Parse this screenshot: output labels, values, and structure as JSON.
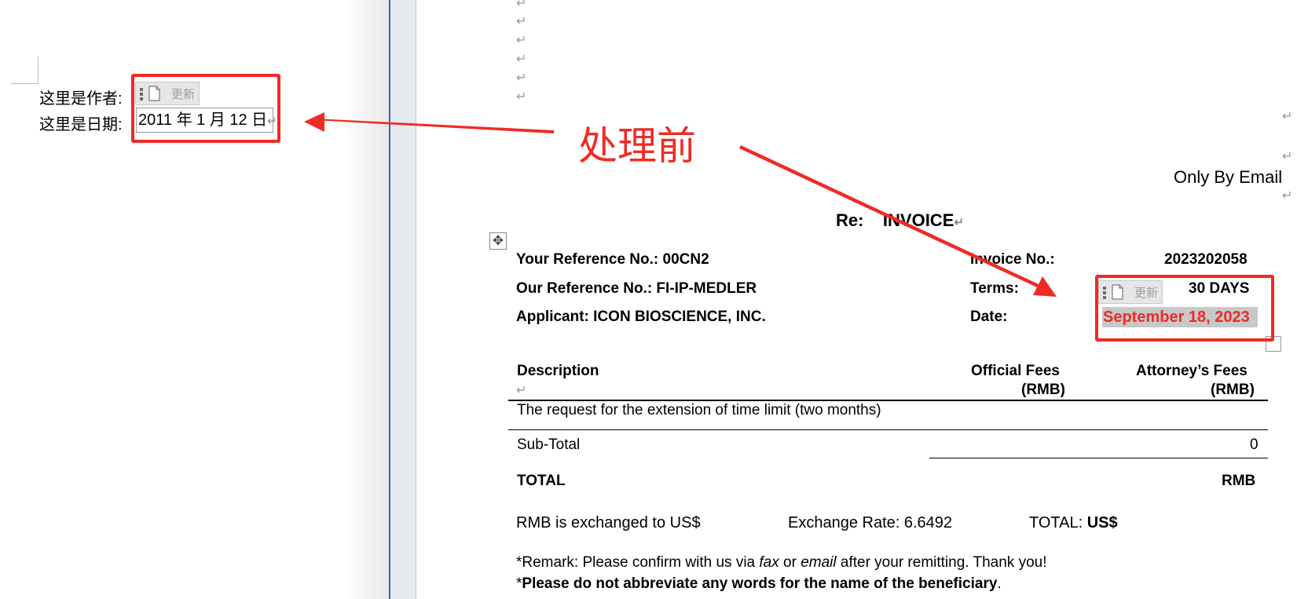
{
  "left_doc": {
    "author_label": "这里是作者:",
    "date_label": "这里是日期:",
    "date_value": "2011 年 1 月 12 日",
    "field_update_label": "更新"
  },
  "annotation": {
    "label": "处理前",
    "color": "#ef2b25"
  },
  "invoice": {
    "only_by_email": "Only By Email",
    "re_label": "Re:",
    "re_title": "INVOICE",
    "your_ref": "Your Reference No.: 00CN2",
    "our_ref": "Our Reference No.: FI-IP-MEDLER",
    "applicant": "Applicant: ICON BIOSCIENCE, INC.",
    "invoice_no_label": "Invoice No.:",
    "invoice_no_value": "2023202058",
    "terms_label": "Terms:",
    "terms_value": "30 DAYS",
    "date_label": "Date:",
    "date_value": "September 18, 2023",
    "field_update_label": "更新",
    "table": {
      "col_description": "Description",
      "col_official_fees": "Official Fees",
      "col_official_unit": "(RMB)",
      "col_attorney_fees": "Attorney’s Fees",
      "col_attorney_unit": "(RMB)",
      "row_item": "The request for the extension of time limit (two months)",
      "subtotal_label": "Sub-Total",
      "subtotal_value": "0",
      "total_label": "TOTAL",
      "total_currency": "RMB"
    },
    "exchange_text": "RMB is exchanged to US$",
    "exchange_rate": "Exchange Rate: 6.6492",
    "total_usd_label": "TOTAL:",
    "total_usd_currency": "US$",
    "remark_prefix": "*Remark: Please confirm with us via ",
    "remark_fax": "fax",
    "remark_or": " or ",
    "remark_email": "email",
    "remark_suffix": " after your remitting. Thank you!",
    "note_star": "*",
    "note_bold": "Please do not abbreviate any words for the name of the beneficiary",
    "note_end": "."
  },
  "colors": {
    "accent_red": "#ef2b25",
    "splitter_blue": "#3d63b5",
    "field_gray": "#c8c8c8"
  },
  "icons": [
    "field-drag-handle-icon",
    "field-document-icon",
    "table-move-handle-icon",
    "paragraph-mark-icon",
    "annotation-arrow-icon"
  ]
}
